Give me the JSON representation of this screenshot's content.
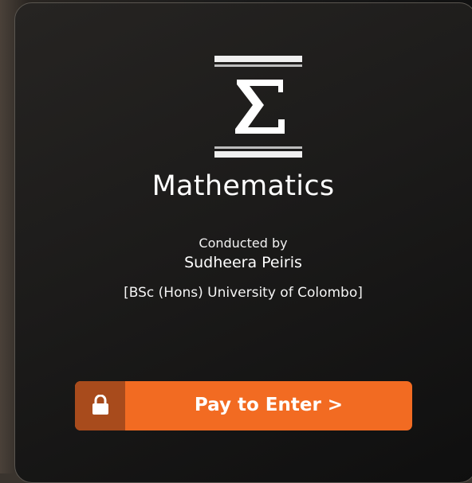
{
  "card": {
    "icon": "sigma-icon",
    "title": "Mathematics",
    "conducted_label": "Conducted by",
    "teacher": "Sudheera Peiris",
    "qualification": "[BSc (Hons) University of Colombo]"
  },
  "action": {
    "lock_icon": "lock-icon",
    "label": "Pay to Enter >"
  },
  "colors": {
    "accent": "#f26b22",
    "lock_bg": "#a84b1c",
    "card_bg": "#1c1b1a"
  }
}
